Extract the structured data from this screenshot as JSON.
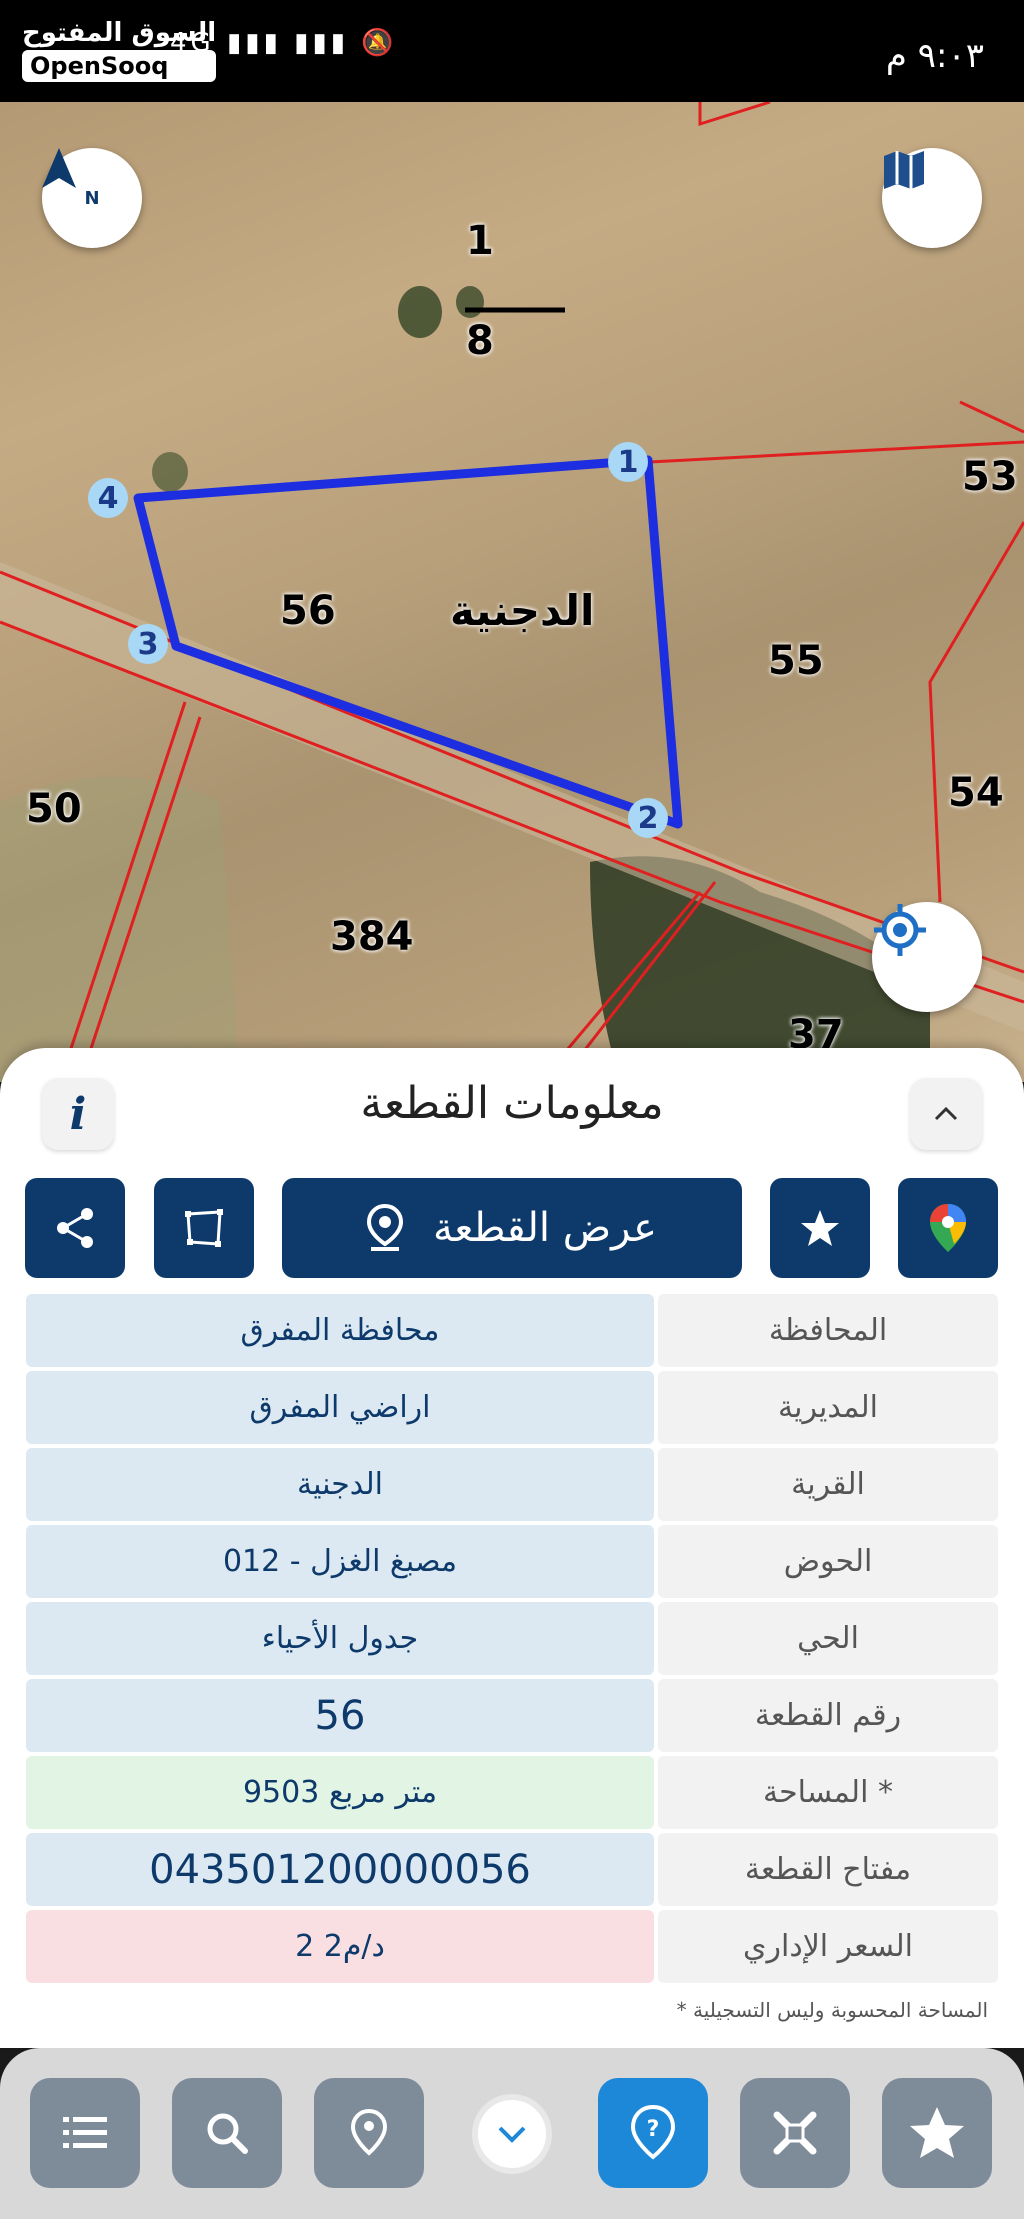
{
  "status_bar": {
    "time": "٩:٠٣ م",
    "network": "4G",
    "speed": "0,1 K/S"
  },
  "watermark": {
    "arabic": "السوق المفتوح",
    "english": "OpenSooq"
  },
  "map": {
    "north_label": "N",
    "parcel_numbers": [
      "1",
      "8",
      "53",
      "56",
      "55",
      "54",
      "50",
      "384",
      "37"
    ],
    "village_label": "الدجنية",
    "corner_markers": [
      "1",
      "2",
      "3",
      "4"
    ]
  },
  "sheet": {
    "title": "معلومات القطعة",
    "info_label": "i",
    "show_parcel_label": "عرض القطعة",
    "rows": [
      {
        "label": "المحافظة",
        "value": "محافظة المفرق"
      },
      {
        "label": "المديرية",
        "value": "اراضي المفرق"
      },
      {
        "label": "القرية",
        "value": "الدجنية"
      },
      {
        "label": "الحوض",
        "value": "مصبغ الغزل - 012"
      },
      {
        "label": "الحي",
        "value": "جدول الأحياء"
      },
      {
        "label": "رقم القطعة",
        "value": "56"
      },
      {
        "label": "المساحة *",
        "value": "9503   متر مربع"
      },
      {
        "label": "مفتاح القطعة",
        "value": "043501200000056"
      },
      {
        "label": "السعر الإداري",
        "value": "2 د/م2"
      }
    ],
    "footnote": "* المساحة المحسوبة وليس التسجيلية"
  },
  "colors": {
    "primary": "#0d3a6b",
    "accent": "#1e88d8",
    "parcel_outline": "#1c2ee0",
    "boundary": "#e02020"
  },
  "nav_icons": [
    "list-icon",
    "search-icon",
    "pin-icon",
    "chevron-down-icon",
    "help-icon",
    "tools-icon",
    "star-icon"
  ]
}
